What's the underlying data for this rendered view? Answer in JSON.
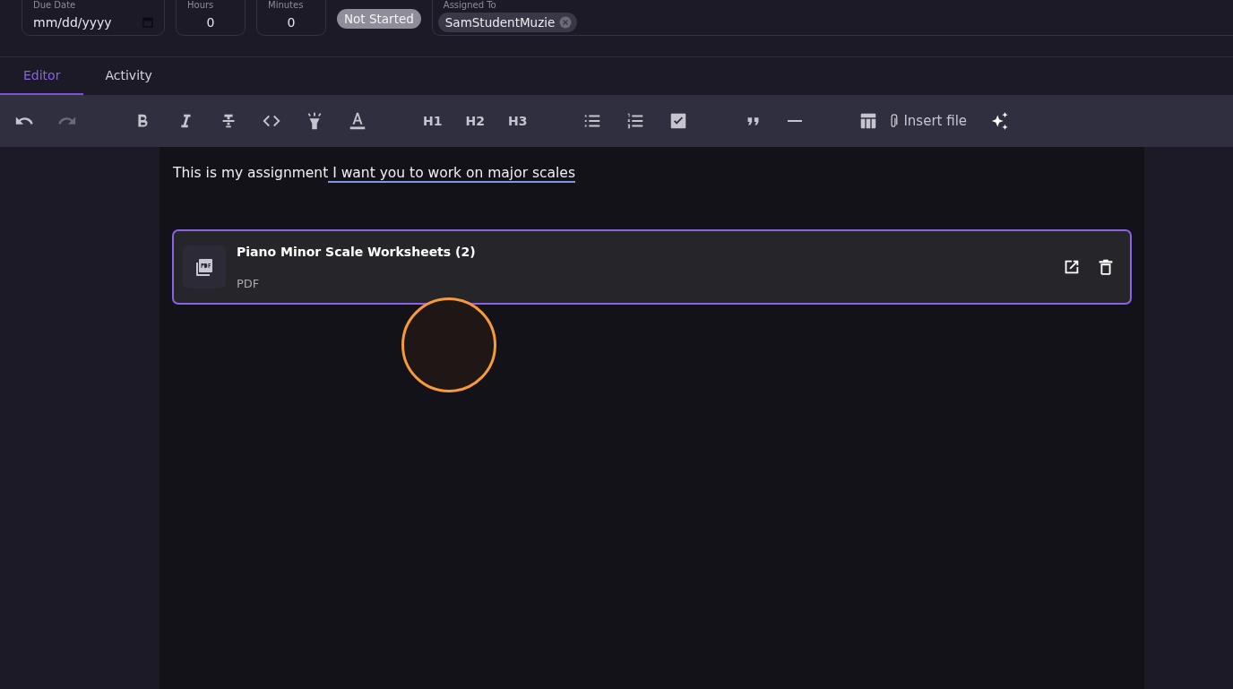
{
  "fields": [
    {
      "label": "Due Date",
      "kind": "date",
      "placeholder": "mm/dd/yyyy"
    },
    {
      "label": "Hours",
      "kind": "number",
      "value": "0"
    },
    {
      "label": "Minutes",
      "kind": "number",
      "value": "0"
    }
  ],
  "status": {
    "label": "Not Started"
  },
  "assigned": {
    "label": "Assigned To",
    "chips": [
      "SamStudentMuzie"
    ]
  },
  "tabs": [
    {
      "label": "Editor",
      "selected": true
    },
    {
      "label": "Activity",
      "selected": false
    }
  ],
  "toolbar": [
    {
      "kind": "undo",
      "disabled": false
    },
    {
      "kind": "redo",
      "disabled": true
    },
    {
      "kind": "gap"
    },
    {
      "kind": "bold",
      "disabled": false
    },
    {
      "kind": "italic",
      "disabled": false
    },
    {
      "kind": "strike",
      "disabled": false
    },
    {
      "kind": "code",
      "disabled": false
    },
    {
      "kind": "highlight",
      "disabled": false
    },
    {
      "kind": "color",
      "disabled": false
    },
    {
      "kind": "gap"
    },
    {
      "kind": "heading",
      "label": "H1",
      "disabled": false
    },
    {
      "kind": "heading",
      "label": "H2",
      "disabled": false
    },
    {
      "kind": "heading",
      "label": "H3",
      "disabled": false
    },
    {
      "kind": "gap"
    },
    {
      "kind": "bullets",
      "disabled": false
    },
    {
      "kind": "numbers",
      "disabled": false
    },
    {
      "kind": "task",
      "disabled": false
    },
    {
      "kind": "gap"
    },
    {
      "kind": "quote",
      "disabled": false
    },
    {
      "kind": "rule",
      "disabled": false
    },
    {
      "kind": "gap"
    },
    {
      "kind": "table",
      "disabled": false
    },
    {
      "kind": "file",
      "label": "Insert file",
      "disabled": false
    },
    {
      "kind": "ai",
      "disabled": false
    }
  ],
  "document": {
    "text": "This is my assignment",
    "flagged_text": " I want you to work on major scales",
    "attachment": {
      "name": "Piano Minor Scale Worksheets (2)",
      "type": "PDF",
      "selected": true
    }
  }
}
